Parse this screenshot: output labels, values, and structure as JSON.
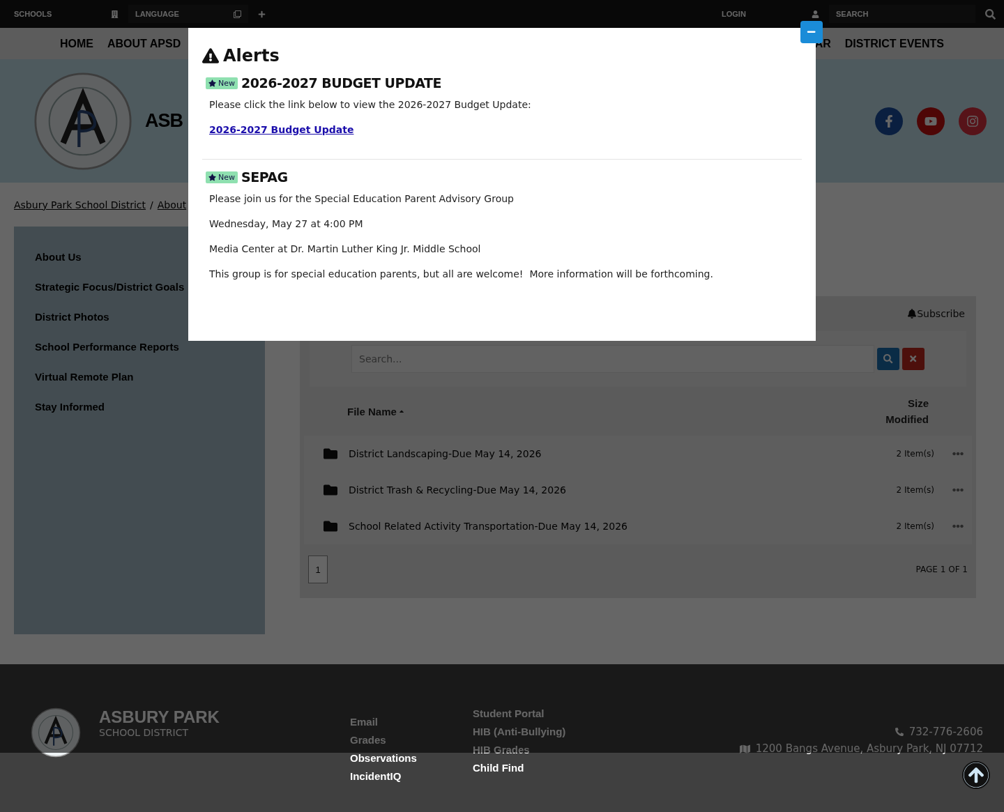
{
  "top_bar": {
    "schools": "SCHOOLS",
    "language": "LANGUAGE",
    "login": "LOGIN",
    "search_placeholder": "SEARCH"
  },
  "nav": {
    "left": [
      "HOME",
      "ABOUT APSD"
    ],
    "right": [
      "AR",
      "DISTRICT EVENTS"
    ]
  },
  "header": {
    "site_name": "ASB"
  },
  "breadcrumb": {
    "items": [
      "Asbury Park School District",
      "About"
    ],
    "separator": "/"
  },
  "sidebar": {
    "items": [
      "About Us",
      "Strategic Focus/District Goals",
      "District Photos",
      "School Performance Reports",
      "Virtual Remote Plan",
      "Stay Informed"
    ]
  },
  "files": {
    "subscribe": "Subscribe",
    "search_placeholder": "Search...",
    "columns": {
      "name": "File Name",
      "size": "Size",
      "modified": "Modified"
    },
    "rows": [
      {
        "name": "District Landscaping-Due May 14, 2026",
        "size": "2 Item(s)"
      },
      {
        "name": "District Trash & Recycling-Due May 14, 2026",
        "size": "2 Item(s)"
      },
      {
        "name": "School Related Activity Transportation-Due May 14, 2026",
        "size": "2 Item(s)"
      }
    ],
    "pages": [
      {
        "label": "1",
        "selected": true
      }
    ],
    "page_info": "PAGE 1 OF 1"
  },
  "footer": {
    "name": "ASBURY PARK",
    "subtitle": "SCHOOL DISTRICT",
    "links_1": [
      "Email",
      "Grades",
      "Observations",
      "IncidentIQ"
    ],
    "links_2": [
      "Student Portal",
      "HIB (Anti-Bullying)",
      "HIB Grades",
      "Child Find"
    ],
    "phone": "732-776-2606",
    "address": "1200 Bangs Avenue, Asbury Park, NJ 07712"
  },
  "modal": {
    "title": "Alerts",
    "alerts": [
      {
        "badge": "New",
        "title": "2026-2027 BUDGET UPDATE",
        "body": [
          {
            "kind": "text",
            "text": "Please click the link below to view the 2026-2027 Budget Update:"
          },
          {
            "kind": "link",
            "text": "2026-2027 Budget Update"
          }
        ]
      },
      {
        "badge": "New",
        "title": "SEPAG",
        "body": [
          {
            "kind": "text",
            "text": "Please join us for the Special Education Parent Advisory Group"
          },
          {
            "kind": "text",
            "text": "Wednesday, May 27 at 4:00 PM"
          },
          {
            "kind": "text",
            "text": "Media Center at Dr. Martin Luther King Jr. Middle School"
          },
          {
            "kind": "text",
            "text": "This group is for special education parents, but all are welcome!  More information will be forthcoming."
          }
        ]
      }
    ]
  }
}
